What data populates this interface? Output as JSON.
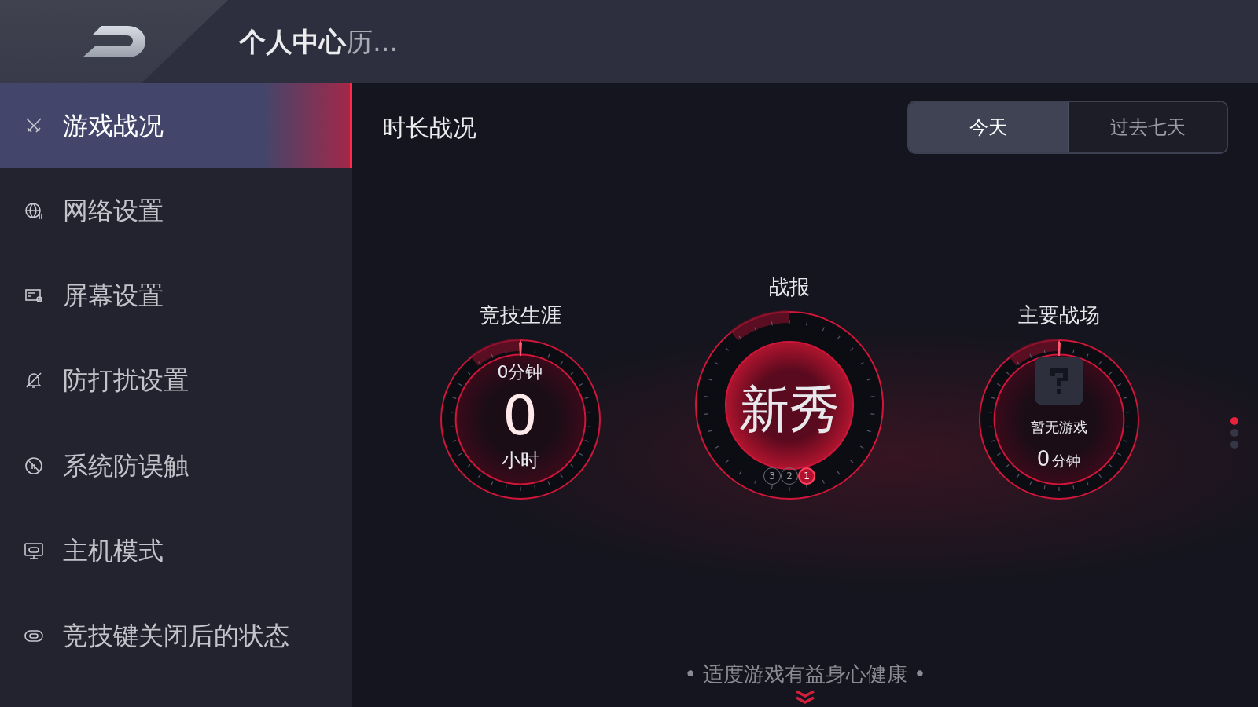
{
  "header": {
    "title": "**个人中心**历..."
  },
  "sidebar": {
    "groups": [
      [
        {
          "label": "游戏战况",
          "selected": true
        },
        {
          "label": "网络设置",
          "selected": false
        },
        {
          "label": "屏幕设置",
          "selected": false
        },
        {
          "label": "防打扰设置",
          "selected": false
        }
      ],
      [
        {
          "label": "系统防误触",
          "selected": false
        },
        {
          "label": "主机模式",
          "selected": false
        },
        {
          "label": "竞技键关闭后的状态",
          "selected": false
        }
      ]
    ]
  },
  "main": {
    "title": "时长战况",
    "periods": [
      {
        "label": "今天",
        "selected": true
      },
      {
        "label": "过去七天",
        "selected": false
      }
    ],
    "gauges": [
      {
        "kind": "time",
        "title": "竞技生涯",
        "top": "0分钟",
        "value": "0",
        "unit": "小时"
      },
      {
        "kind": "rank",
        "title": "战报",
        "value": "新秀",
        "ranks": [
          {
            "label": "3",
            "selected": false
          },
          {
            "label": "2",
            "selected": false
          },
          {
            "label": "1",
            "selected": true
          }
        ]
      },
      {
        "kind": "game",
        "title": "主要战场",
        "name": "暂无游戏",
        "value": "0",
        "unit": "分钟"
      }
    ],
    "page_dots": [
      {
        "selected": true
      },
      {
        "selected": false
      },
      {
        "selected": false
      }
    ],
    "footer": "• 适度游戏有益身心健康 •"
  }
}
